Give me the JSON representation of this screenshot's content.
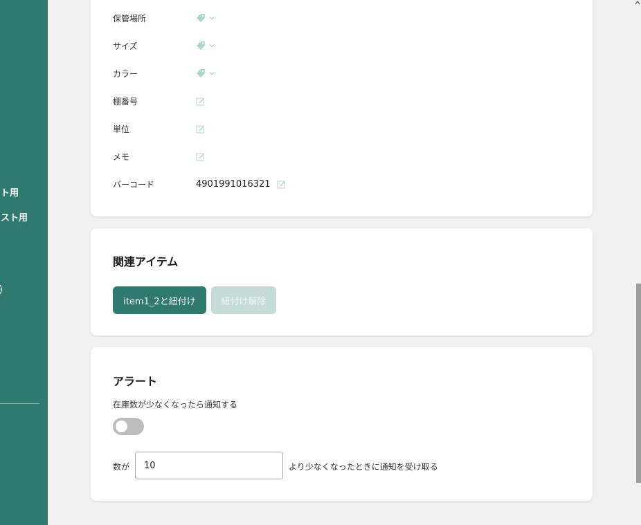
{
  "sidebar": {
    "items": [
      {
        "label": "ト用"
      },
      {
        "label": "スト用"
      },
      {
        "label": ")"
      }
    ]
  },
  "properties": {
    "rows": [
      {
        "label": "保管場所",
        "type": "tag"
      },
      {
        "label": "サイズ",
        "type": "tag"
      },
      {
        "label": "カラー",
        "type": "tag"
      },
      {
        "label": "棚番号",
        "type": "edit"
      },
      {
        "label": "単位",
        "type": "edit"
      },
      {
        "label": "メモ",
        "type": "edit"
      },
      {
        "label": "バーコード",
        "type": "edit",
        "value": "4901991016321"
      }
    ]
  },
  "related": {
    "title": "関連アイテム",
    "link_button": "item1_2と紐付け",
    "unlink_button": "紐付け解除"
  },
  "alert": {
    "title": "アラート",
    "description": "在庫数が少なくなったら通知する",
    "toggle_on": false,
    "threshold_prefix": "数が",
    "threshold_value": "10",
    "threshold_suffix": "より少なくなったときに通知を受け取る"
  },
  "colors": {
    "brand": "#2e7a6e",
    "brand_disabled": "#c6dcd8",
    "icon_light": "#a8d8c8"
  }
}
